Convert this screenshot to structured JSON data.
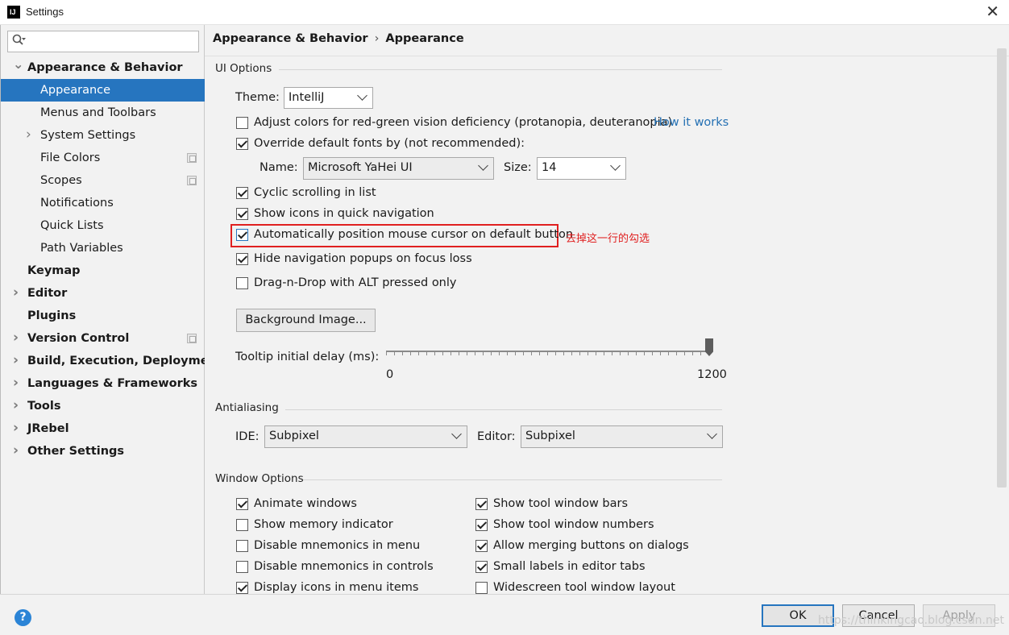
{
  "window": {
    "title": "Settings",
    "app_icon_text": "IJ",
    "close_glyph": "✕"
  },
  "search": {
    "placeholder": "",
    "icon": "search-icon"
  },
  "sidebar": {
    "items": [
      {
        "label": "Appearance & Behavior",
        "bold": true,
        "expanded": true
      },
      {
        "label": "Appearance",
        "selected": true
      },
      {
        "label": "Menus and Toolbars"
      },
      {
        "label": "System Settings",
        "expandable": true
      },
      {
        "label": "File Colors",
        "project_icon": true
      },
      {
        "label": "Scopes",
        "project_icon": true
      },
      {
        "label": "Notifications"
      },
      {
        "label": "Quick Lists"
      },
      {
        "label": "Path Variables"
      },
      {
        "label": "Keymap",
        "bold": true
      },
      {
        "label": "Editor",
        "bold": true,
        "expandable": true
      },
      {
        "label": "Plugins",
        "bold": true
      },
      {
        "label": "Version Control",
        "bold": true,
        "expandable": true,
        "project_icon": true
      },
      {
        "label": "Build, Execution, Deployment",
        "bold": true,
        "expandable": true
      },
      {
        "label": "Languages & Frameworks",
        "bold": true,
        "expandable": true
      },
      {
        "label": "Tools",
        "bold": true,
        "expandable": true
      },
      {
        "label": "JRebel",
        "bold": true,
        "expandable": true
      },
      {
        "label": "Other Settings",
        "bold": true,
        "expandable": true
      }
    ]
  },
  "breadcrumb": {
    "parent": "Appearance & Behavior",
    "separator": "›",
    "current": "Appearance"
  },
  "ui_options": {
    "title": "UI Options",
    "theme_label": "Theme:",
    "theme_value": "IntelliJ",
    "adjust_colors": {
      "label": "Adjust colors for red-green vision deficiency (protanopia, deuteranopia)",
      "checked": false
    },
    "how_it_works": "How it works",
    "override_fonts": {
      "label": "Override default fonts by (not recommended):",
      "checked": true
    },
    "font_name_label": "Name:",
    "font_name_value": "Microsoft YaHei UI",
    "font_size_label": "Size:",
    "font_size_value": "14",
    "cyclic_scrolling": {
      "label": "Cyclic scrolling in list",
      "checked": true
    },
    "show_icons_nav": {
      "label": "Show icons in quick navigation",
      "checked": true
    },
    "auto_position_mouse": {
      "label": "Automatically position mouse cursor on default button",
      "checked": true
    },
    "annotation": "去掉这一行的勾选",
    "hide_nav_popups": {
      "label": "Hide navigation popups on focus loss",
      "checked": true
    },
    "drag_drop_alt": {
      "label": "Drag-n-Drop with ALT pressed only",
      "checked": false
    },
    "background_image_button": "Background Image...",
    "tooltip_delay_label": "Tooltip initial delay (ms):",
    "tooltip_delay_min": "0",
    "tooltip_delay_max": "1200",
    "tooltip_delay_value": 1200
  },
  "antialiasing": {
    "title": "Antialiasing",
    "ide_label": "IDE:",
    "ide_value": "Subpixel",
    "editor_label": "Editor:",
    "editor_value": "Subpixel"
  },
  "window_options": {
    "title": "Window Options",
    "left": [
      {
        "label": "Animate windows",
        "checked": true
      },
      {
        "label": "Show memory indicator",
        "checked": false
      },
      {
        "label": "Disable mnemonics in menu",
        "checked": false
      },
      {
        "label": "Disable mnemonics in controls",
        "checked": false
      },
      {
        "label": "Display icons in menu items",
        "checked": true
      }
    ],
    "right": [
      {
        "label": "Show tool window bars",
        "checked": true
      },
      {
        "label": "Show tool window numbers",
        "checked": true
      },
      {
        "label": "Allow merging buttons on dialogs",
        "checked": true
      },
      {
        "label": "Small labels in editor tabs",
        "checked": true
      },
      {
        "label": "Widescreen tool window layout",
        "checked": false
      }
    ]
  },
  "footer": {
    "help_glyph": "?",
    "ok": "OK",
    "cancel": "Cancel",
    "apply": "Apply",
    "watermark": "https://thinkingcao.blog.csdn.net"
  },
  "colors": {
    "selection": "#2675bf",
    "link": "#2470b3",
    "annotation": "#e02020"
  }
}
